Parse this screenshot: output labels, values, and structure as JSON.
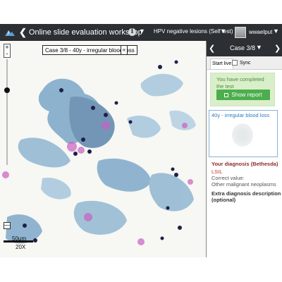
{
  "header": {
    "title": "Online slide evaluation workshop",
    "info_icon": "info-icon",
    "test_name": "HPV negative lesions (Self test)",
    "username": "wwaelput"
  },
  "viewer": {
    "case_label": "Case 3/8 - 40y - irregular blood loss",
    "collapse_symbol": "«",
    "zoom_in": "+",
    "zoom_out": "-",
    "minimap_symbol": "—",
    "scale_text": "50μm",
    "magnification": "20X"
  },
  "panel": {
    "case_title": "Case 3/8",
    "tabs": {
      "live": "Start live",
      "sync": "Sync"
    },
    "completed_text": "You have completed the test",
    "show_report": "Show report",
    "slide_title": "40y - irregular blood loss",
    "diagnosis_heading": "Your diagnosis (Bethesda)",
    "diagnosis_value": "LSIL",
    "correct_label": "Correct value:",
    "correct_value": "Other malignant neoplasms",
    "extra_heading": "Extra diagnosis description (optional)"
  },
  "colors": {
    "topbar": "#2c2f33",
    "success_bg": "#d9efc9",
    "success_btn": "#4cae4c",
    "diagnosis": "#8b2b2b",
    "link": "#2a7bbd"
  }
}
